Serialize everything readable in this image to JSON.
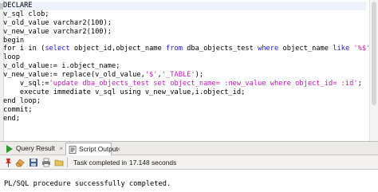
{
  "editor": {
    "lines": [
      [
        {
          "t": "DECLARE",
          "k": ""
        }
      ],
      [
        {
          "t": "v_sql clob;",
          "k": ""
        }
      ],
      [
        {
          "t": "v_old_value varchar2(100);",
          "k": ""
        }
      ],
      [
        {
          "t": "v_new_value varchar2(100);",
          "k": ""
        }
      ],
      [
        {
          "t": "begin",
          "k": ""
        }
      ],
      [
        {
          "t": "for i in (",
          "k": ""
        },
        {
          "t": "select",
          "k": "kw"
        },
        {
          "t": " object_id,object_name ",
          "k": ""
        },
        {
          "t": "from",
          "k": "kw"
        },
        {
          "t": " dba_objects_test ",
          "k": ""
        },
        {
          "t": "where",
          "k": "kw"
        },
        {
          "t": " object_name ",
          "k": ""
        },
        {
          "t": "like",
          "k": "kw"
        },
        {
          "t": " ",
          "k": ""
        },
        {
          "t": "'%$'",
          "k": "str"
        },
        {
          "t": ")",
          "k": ""
        }
      ],
      [
        {
          "t": "loop",
          "k": ""
        }
      ],
      [
        {
          "t": "v_old_value:= i.object_name;",
          "k": ""
        }
      ],
      [
        {
          "t": "v_new_value:= replace(v_old_value,",
          "k": ""
        },
        {
          "t": "'$'",
          "k": "str"
        },
        {
          "t": ",",
          "k": ""
        },
        {
          "t": "'_TABLE'",
          "k": "str"
        },
        {
          "t": ");",
          "k": ""
        }
      ],
      [
        {
          "t": "    v_sql:=",
          "k": ""
        },
        {
          "t": "'update dba_objects_test set object_name= :new_value where object_id= :id'",
          "k": "str"
        },
        {
          "t": ";",
          "k": ""
        }
      ],
      [
        {
          "t": "    execute immediate v_sql using v_new_value,i.object_id;",
          "k": ""
        }
      ],
      [
        {
          "t": "end loop;",
          "k": ""
        }
      ],
      [
        {
          "t": "commit;",
          "k": ""
        }
      ],
      [
        {
          "t": "end;",
          "k": ""
        }
      ]
    ]
  },
  "tabs": {
    "query_result": "Query Result",
    "script_output": "Script Output"
  },
  "toolbar": {
    "status_prefix": "Task completed in",
    "status_time": "17.148 seconds"
  },
  "output": {
    "message": "PL/SQL procedure successfully completed."
  },
  "colors": {
    "keyword": "#1d1ad6",
    "string": "#c21ab5",
    "current_line": "#eef2fb"
  },
  "icons": {
    "query_result_tab": "play-icon",
    "script_output_tab": "script-icon",
    "pin": "pin-icon",
    "clear": "eraser-icon",
    "save": "save-icon",
    "print": "print-icon",
    "open": "open-file-icon"
  }
}
